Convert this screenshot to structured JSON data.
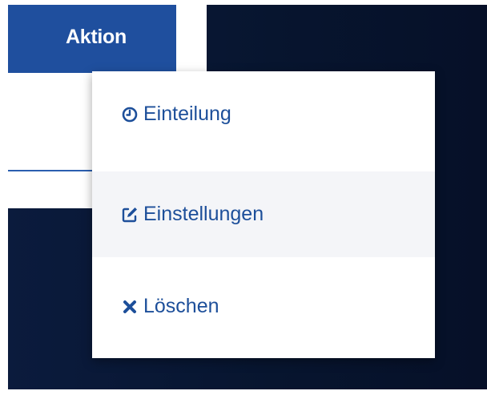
{
  "table": {
    "header_label": "Aktion"
  },
  "menu": {
    "items": [
      {
        "label": "Einteilung",
        "icon": "clock-icon"
      },
      {
        "label": "Einstellungen",
        "icon": "edit-icon"
      },
      {
        "label": "Löschen",
        "icon": "close-icon"
      }
    ]
  },
  "colors": {
    "header_bg": "#1f4f9e",
    "menu_text": "#1d4f9a",
    "background": "#0b1b3d",
    "hover_bg": "#f4f5f8"
  }
}
